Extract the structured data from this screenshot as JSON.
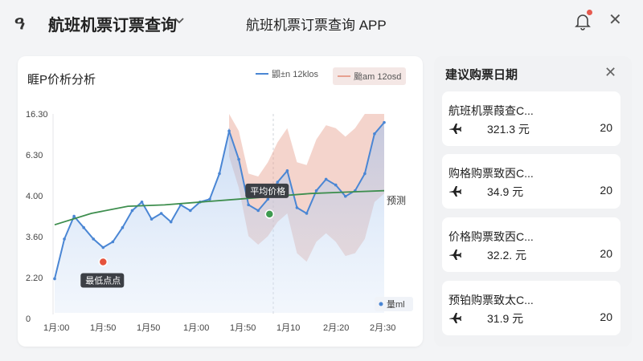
{
  "header": {
    "logo": "ዓ",
    "app_title": "航班机票订票查询",
    "center_title": "航班机票订票查询 APP"
  },
  "chart": {
    "title": "睚P价析分析",
    "legend": [
      {
        "label": "鼰±n 12klos",
        "color": "#4a86d4"
      },
      {
        "label": "颱am 12osd",
        "color": "#e6a08f"
      }
    ],
    "min_label": "最低点点",
    "avg_label": "平均价格",
    "forecast_label": "预测",
    "corner_label": "量ml",
    "colors": {
      "line": "#4a86d4",
      "trend": "#3e8e4e",
      "band": "#e6a08f",
      "min": "#e5533d",
      "avg": "#3e9a4f"
    }
  },
  "chart_data": {
    "type": "line",
    "x_ticks": [
      "1月:00",
      "1月:50",
      "1月50",
      "1月:00",
      "1月:50",
      "1月10",
      "2月:20",
      "2月:30"
    ],
    "y_ticks": [
      "16.30",
      "6.30",
      "4.00",
      "3.60",
      "2.20",
      "0"
    ],
    "series": [
      {
        "name": "鼰±n 12klos",
        "values": [
          1.2,
          2.6,
          3.4,
          3.0,
          2.6,
          2.3,
          2.5,
          3.0,
          3.6,
          3.9,
          3.3,
          3.5,
          3.2,
          3.8,
          3.6,
          3.9,
          4.0,
          4.9,
          6.4,
          5.4,
          3.8,
          3.6,
          4.0,
          4.6,
          5.0,
          3.7,
          3.5,
          4.3,
          4.7,
          4.5,
          4.1,
          4.3,
          4.9,
          6.3,
          6.7
        ]
      },
      {
        "name": "trend",
        "values": [
          3.1,
          3.5,
          3.75,
          3.8,
          3.9,
          4.0,
          4.1,
          4.2,
          4.25,
          4.3
        ]
      }
    ],
    "min_point": {
      "x_index": 5,
      "value": 2.3
    },
    "avg_point": {
      "x_index": 22,
      "value": 3.7
    }
  },
  "side": {
    "title": "建议购票日期",
    "items": [
      {
        "name": "航班机票葭查C...",
        "price": "321.3 元",
        "count": "20"
      },
      {
        "name": "购格购票致㐁C...",
        "price": "34.9 元",
        "count": "20"
      },
      {
        "name": "价格购票致㐁C...",
        "price": "32.2. 元",
        "count": "20"
      },
      {
        "name": "预铂购票致太C...",
        "price": "31.9 元",
        "count": "20"
      }
    ]
  }
}
